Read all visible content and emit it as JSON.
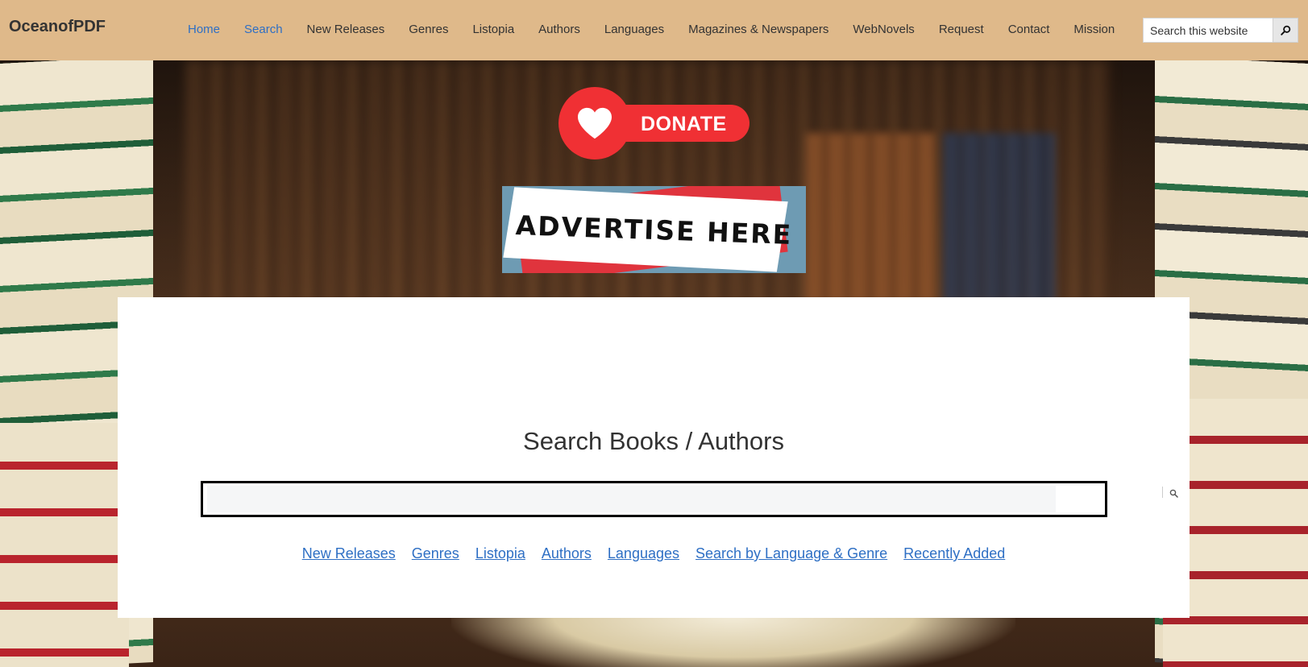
{
  "header": {
    "brand": "OceanofPDF",
    "nav": [
      {
        "label": "Home",
        "active": true
      },
      {
        "label": "Search",
        "active": true
      },
      {
        "label": "New Releases",
        "active": false
      },
      {
        "label": "Genres",
        "active": false
      },
      {
        "label": "Listopia",
        "active": false
      },
      {
        "label": "Authors",
        "active": false
      },
      {
        "label": "Languages",
        "active": false
      },
      {
        "label": "Magazines & Newspapers",
        "active": false
      },
      {
        "label": "WebNovels",
        "active": false
      },
      {
        "label": "Request",
        "active": false
      },
      {
        "label": "Contact",
        "active": false
      },
      {
        "label": "Mission",
        "active": false
      }
    ],
    "search": {
      "placeholder": "Search this website",
      "value": "",
      "icon": "search-icon"
    }
  },
  "donate": {
    "label": "DONATE",
    "icon": "heart-icon"
  },
  "advert": {
    "text": "ADVERTISE HERE"
  },
  "main": {
    "title": "Search Books / Authors",
    "search": {
      "value": "",
      "icon": "search-icon"
    },
    "links": [
      "New Releases",
      "Genres",
      "Listopia",
      "Authors",
      "Languages",
      "Search by Language & Genre",
      "Recently Added"
    ]
  },
  "colors": {
    "header_bg": "#dfb98a",
    "link": "#2e6fc4",
    "donate_red": "#f03034",
    "text": "#333333"
  }
}
